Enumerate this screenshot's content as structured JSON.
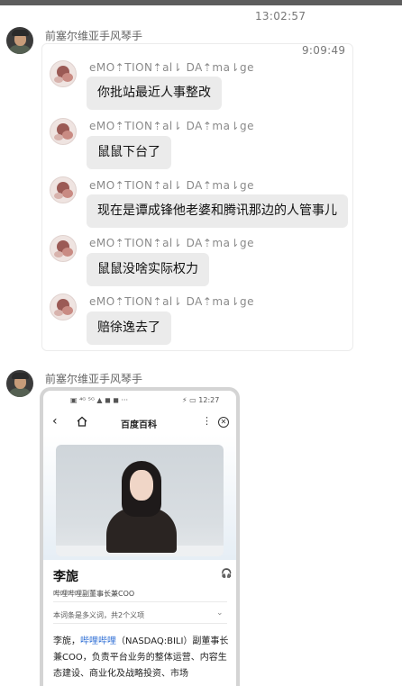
{
  "top_time": "13:02:57",
  "sender_1": "前塞尔维亚手风琴手",
  "forward": {
    "time": "9:09:49",
    "messages": [
      {
        "nick": "eMO⇡TION⇡al⇂ DA⇡ma⇂ge",
        "text": "你批站最近人事整改"
      },
      {
        "nick": "eMO⇡TION⇡al⇂ DA⇡ma⇂ge",
        "text": "鼠鼠下台了"
      },
      {
        "nick": "eMO⇡TION⇡al⇂ DA⇡ma⇂ge",
        "text": "现在是谭成锋他老婆和腾讯那边的人管事儿"
      },
      {
        "nick": "eMO⇡TION⇡al⇂ DA⇡ma⇂ge",
        "text": "鼠鼠没啥实际权力"
      },
      {
        "nick": "eMO⇡TION⇡al⇂ DA⇡ma⇂ge",
        "text": "赔徐逸去了"
      }
    ]
  },
  "sender_2": "前塞尔维亚手风琴手",
  "screenshot": {
    "status_left": "▣ ⁴ᴳ ⁵ᴳ ▲ ◼ ◼ ···",
    "status_right": "⚡ ▭ 12:27",
    "nav_title": "百度百科",
    "more_icon": "⋮",
    "close_icon": "✕",
    "back_icon": "‹",
    "headset_icon": "🎧",
    "name": "李旎",
    "subtitle": "哔哩哔哩副董事长兼COO",
    "multi_meaning": "本词条是多义词，共2个义项",
    "chevron": "⌄",
    "para_start": "李旎，",
    "para_link": "哔哩哔哩",
    "para_rest": "（NASDAQ:BILI）副董事长兼COO，负责平台业务的整体运营、内容生态建设、商业化及战略投资、市场"
  }
}
